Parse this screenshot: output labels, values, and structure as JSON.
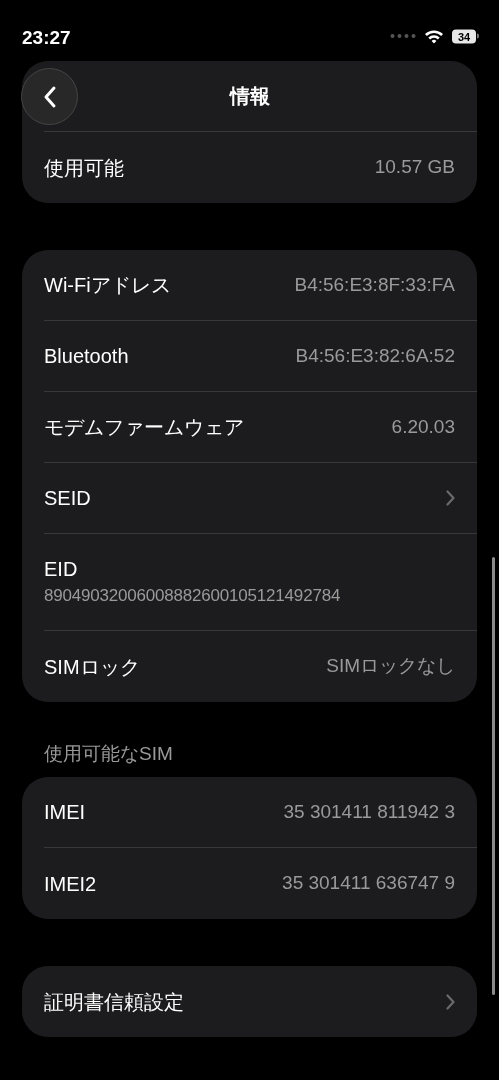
{
  "status_bar": {
    "time": "23:27",
    "battery": "34"
  },
  "nav": {
    "title": "情報"
  },
  "groups": [
    {
      "rows": [
        {
          "kind": "obscured"
        },
        {
          "kind": "value",
          "label": "使用可能",
          "value": "10.57 GB"
        }
      ]
    },
    {
      "rows": [
        {
          "kind": "value",
          "label": "Wi-Fiアドレス",
          "value": "B4:56:E3:8F:33:FA"
        },
        {
          "kind": "value",
          "label": "Bluetooth",
          "value": "B4:56:E3:82:6A:52"
        },
        {
          "kind": "value",
          "label": "モデムファームウェア",
          "value": "6.20.03"
        },
        {
          "kind": "link",
          "label": "SEID"
        },
        {
          "kind": "stacked",
          "label": "EID",
          "value": "89049032006008882600105121492784"
        },
        {
          "kind": "value",
          "label": "SIMロック",
          "value": "SIMロックなし"
        }
      ]
    },
    {
      "header": "使用可能なSIM",
      "rows": [
        {
          "kind": "value",
          "label": "IMEI",
          "value": "35 301411 811942 3"
        },
        {
          "kind": "value",
          "label": "IMEI2",
          "value": "35 301411 636747 9"
        }
      ]
    },
    {
      "rows": [
        {
          "kind": "link",
          "label": "証明書信頼設定"
        }
      ]
    }
  ]
}
